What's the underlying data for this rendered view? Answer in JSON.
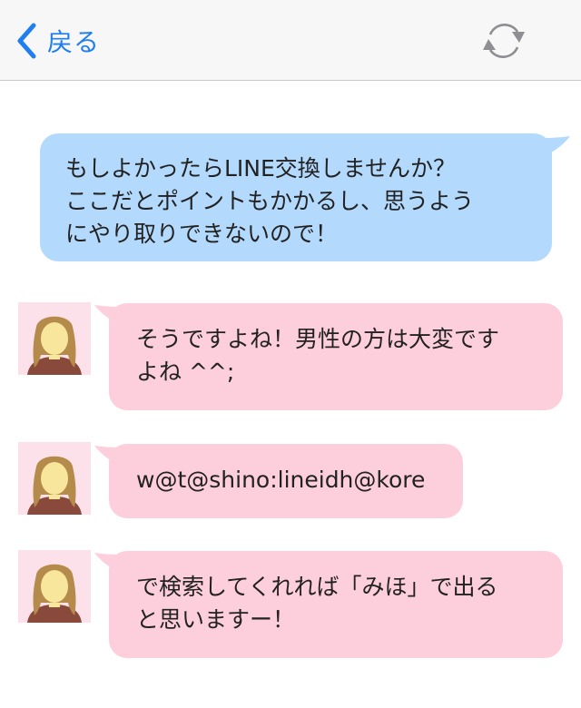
{
  "nav": {
    "back_label": "戻る",
    "back_icon": "chevron-left-icon",
    "refresh_icon": "refresh-icon",
    "accent_color": "#1f7ff0"
  },
  "messages": [
    {
      "direction": "outgoing",
      "text": "もしよかったらLINE交換しませんか？\nここだとポイントもかかるし、思うよう\nにやり取りできないので！",
      "bubble_color": "#b3d9fd"
    },
    {
      "direction": "incoming",
      "text": "そうですよね！男性の方は大変です\nよね ^^;",
      "bubble_color": "#fdcfdc",
      "avatar": "female-avatar-icon"
    },
    {
      "direction": "incoming",
      "text": "w@t@shino:lineidh@kore",
      "bubble_color": "#fdcfdc",
      "avatar": "female-avatar-icon"
    },
    {
      "direction": "incoming",
      "text": "で検索してくれれば「みほ」で出る\nと思いますー！",
      "bubble_color": "#fdcfdc",
      "avatar": "female-avatar-icon"
    }
  ]
}
